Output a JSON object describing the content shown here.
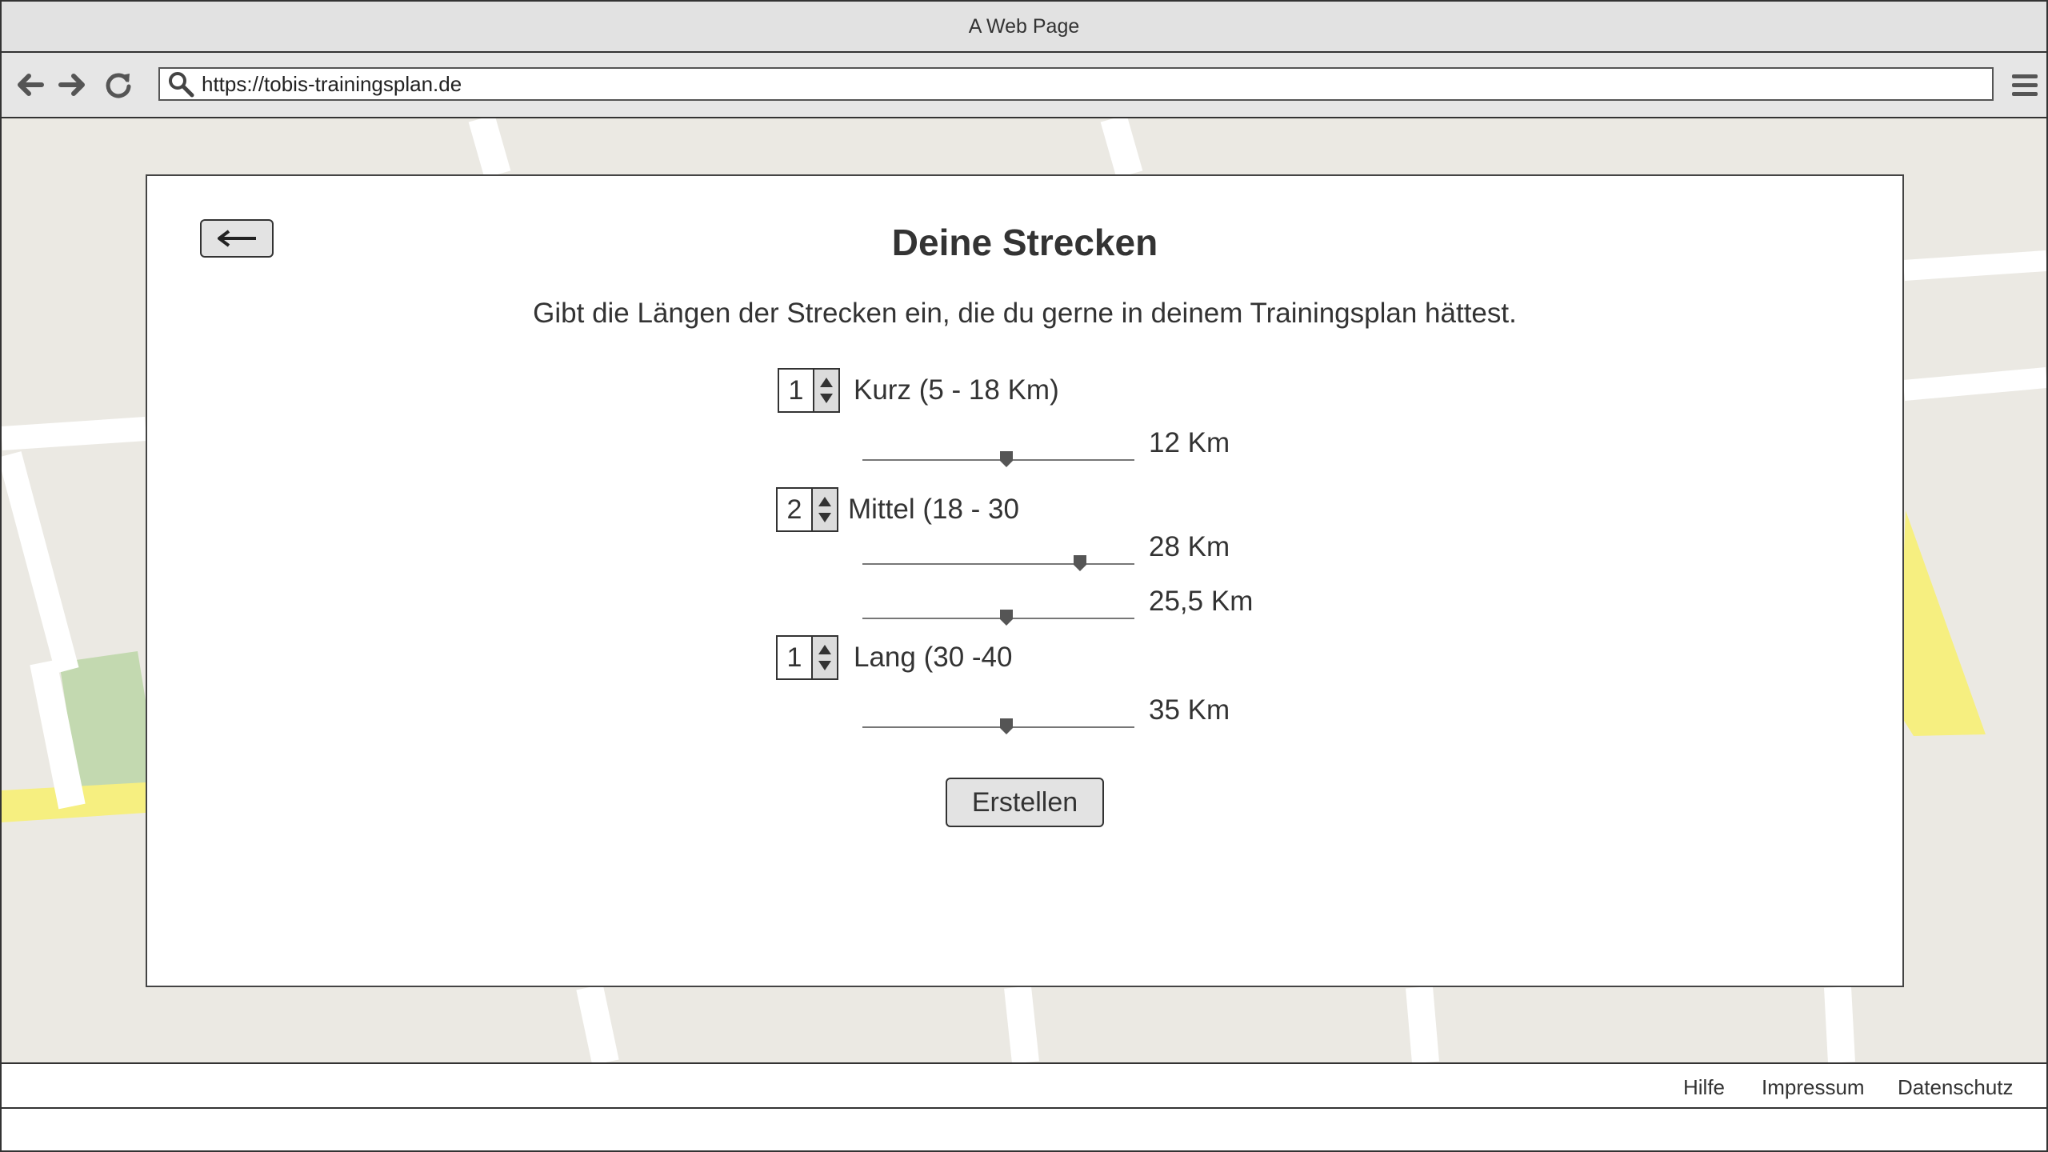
{
  "window": {
    "title": "A Web Page"
  },
  "browser": {
    "url": "https://tobis-trainingsplan.de",
    "icons": [
      "back-arrow-icon",
      "forward-arrow-icon",
      "reload-icon",
      "search-icon",
      "hamburger-menu-icon"
    ]
  },
  "dialog": {
    "back_icon": "left-arrow-icon",
    "title": "Deine Strecken",
    "subtitle": "Gibt die Längen der Strecken ein, die du gerne in deinem Trainingsplan hättest.",
    "categories": [
      {
        "count": "1",
        "label": "Kurz (5 - 18 Km)",
        "sliders": [
          {
            "value_label": "12 Km",
            "fraction": 0.53
          }
        ]
      },
      {
        "count": "2",
        "label": "Mittel (18 - 30",
        "sliders": [
          {
            "value_label": "28 Km",
            "fraction": 0.8
          },
          {
            "value_label": "25,5 Km",
            "fraction": 0.53
          }
        ]
      },
      {
        "count": "1",
        "label": "Lang (30 -40",
        "sliders": [
          {
            "value_label": "35 Km",
            "fraction": 0.53
          }
        ]
      }
    ],
    "submit_label": "Erstellen"
  },
  "footer": {
    "links": [
      "Hilfe",
      "Impressum",
      "Datenschutz"
    ]
  },
  "colors": {
    "map_background": "#ebe9e3",
    "map_road": "#ffffff",
    "map_park": "#c3d9b0",
    "map_highway": "#f6ef80"
  }
}
